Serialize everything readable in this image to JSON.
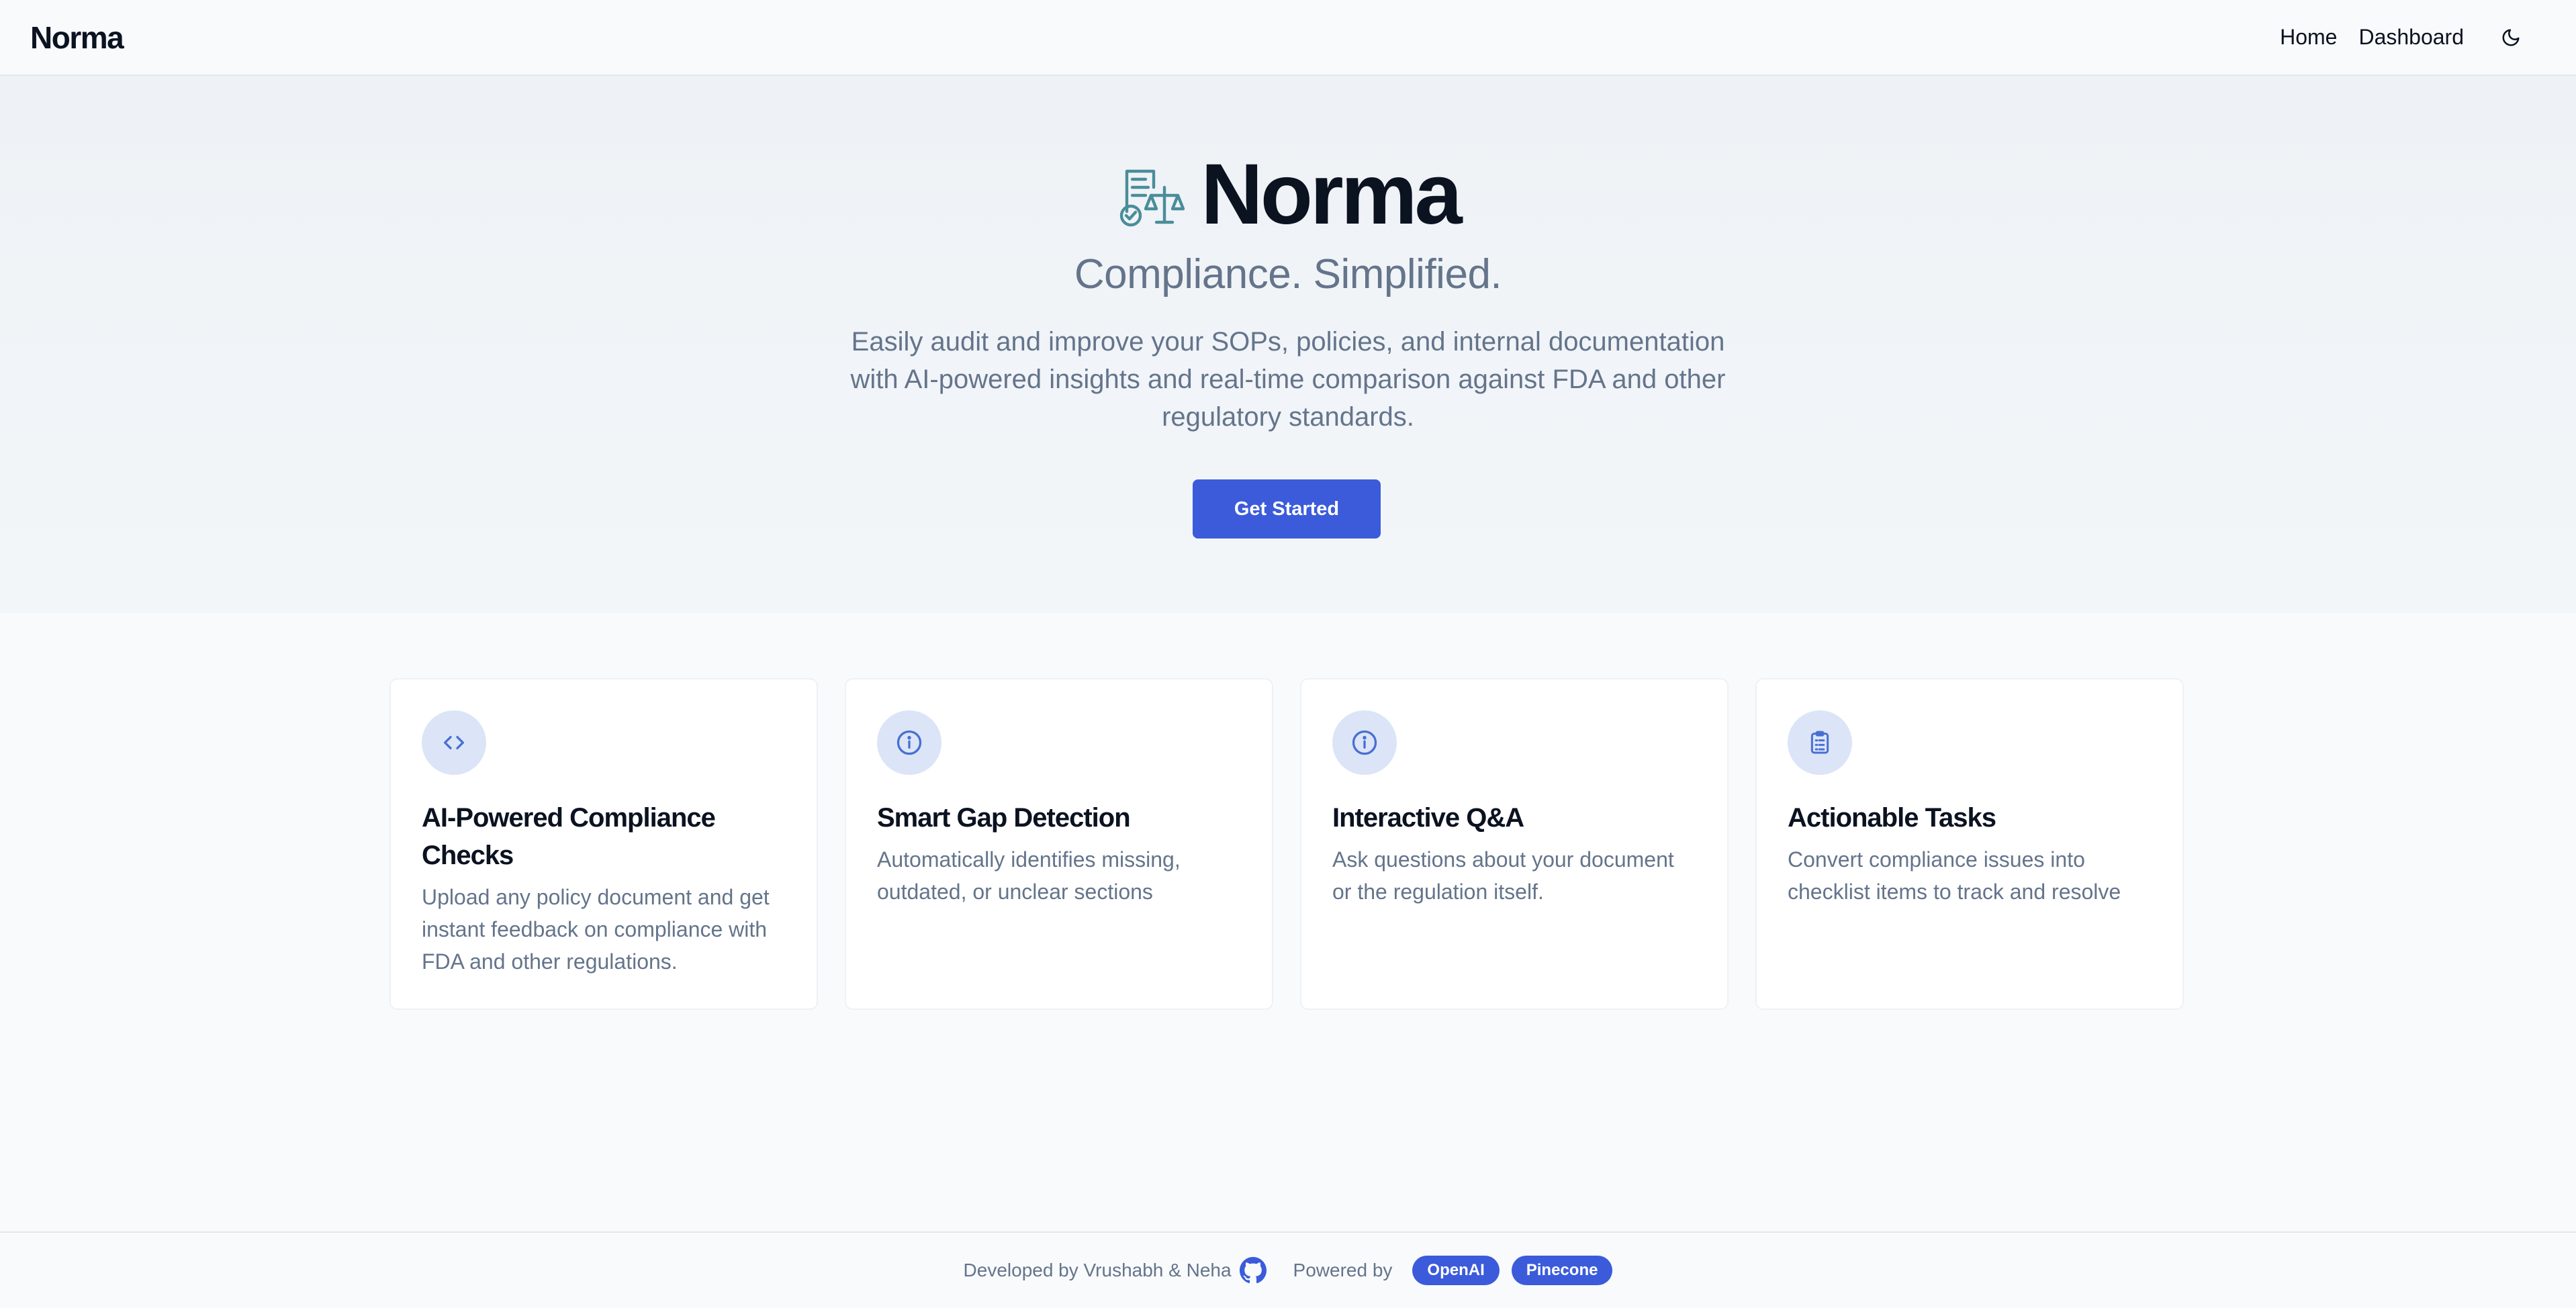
{
  "nav": {
    "brand": "Norma",
    "links": [
      "Home",
      "Dashboard"
    ],
    "theme_icon": "moon-icon"
  },
  "hero": {
    "logo_icon": "document-scale-icon",
    "title": "Norma",
    "tagline": "Compliance. Simplified.",
    "description": "Easily audit and improve your SOPs, policies, and internal documentation with AI-powered insights and real-time comparison against FDA and other regulatory standards.",
    "cta_label": "Get Started"
  },
  "features": [
    {
      "icon": "code-icon",
      "title": "AI-Powered Compliance Checks",
      "text": "Upload any policy document and get instant feedback on compliance with FDA and other regulations."
    },
    {
      "icon": "info-icon",
      "title": "Smart Gap Detection",
      "text": "Automatically identifies missing, outdated, or unclear sections"
    },
    {
      "icon": "info-icon",
      "title": "Interactive Q&A",
      "text": "Ask questions about your document or the regulation itself."
    },
    {
      "icon": "clipboard-icon",
      "title": "Actionable Tasks",
      "text": "Convert compliance issues into checklist items to track and resolve"
    }
  ],
  "footer": {
    "developed_by": "Developed by Vrushabh & Neha",
    "github_icon": "github-icon",
    "powered_by": "Powered by",
    "badges": [
      "OpenAI",
      "Pinecone"
    ]
  },
  "colors": {
    "accent": "#3b5bdb",
    "icon_bg": "#dbe5f7",
    "icon_stroke": "#4a6fd1",
    "logo_teal": "#4a8d9a",
    "muted_text": "#64748b"
  }
}
